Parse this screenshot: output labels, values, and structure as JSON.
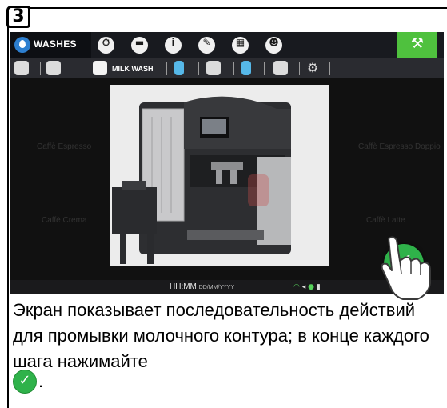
{
  "step": {
    "number": "3"
  },
  "topbar": {
    "wash_label": "WASHES",
    "icons": [
      "clock-icon",
      "folder-icon",
      "info-icon",
      "pencil-icon",
      "calculator-icon",
      "user-icon"
    ],
    "key_icon": "wrench-icon",
    "accent": "#4fc13e"
  },
  "tabbar": {
    "milk_wash_label": "MILK WASH",
    "icons": [
      "coffee-wash-icon",
      "water-wash-icon",
      "milk-carton-icon",
      "glass-icon",
      "jug-icon",
      "glass-icon-2",
      "cup-icon",
      "gear-icon"
    ]
  },
  "content": {
    "side_labels": [
      "Caffè Espresso",
      "Caffè Espresso Doppio",
      "Caffè Crema",
      "Caffè Latte"
    ]
  },
  "status": {
    "time": "HH:MM",
    "date": "DD/MM/YYYY"
  },
  "confirm": {
    "color": "#2fb24a"
  },
  "caption": {
    "text": "Экран показывает последовательность действий для промывки молочного контура; в конце каждого шага нажимайте",
    "period": "."
  }
}
